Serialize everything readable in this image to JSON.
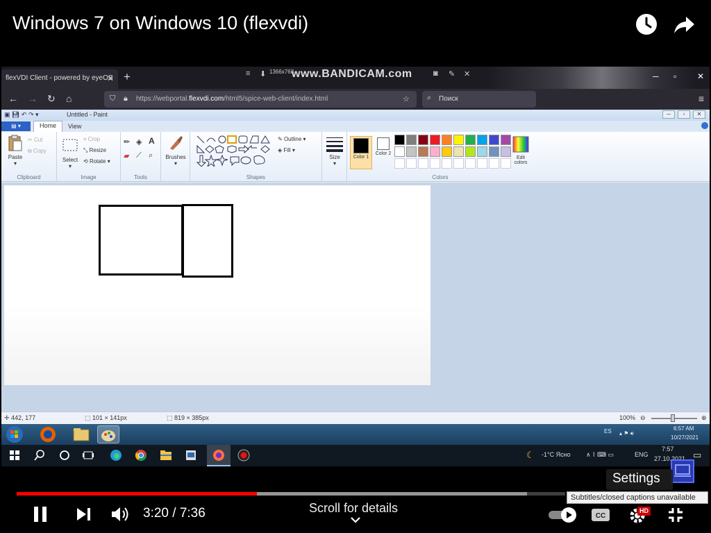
{
  "player": {
    "title": "Windows 7 on Windows 10 (flexvdi)",
    "time_current": "3:20",
    "time_total": "7:36",
    "time_display": "3:20 / 7:36",
    "progress_played": 0.438,
    "progress_buffered": 0.93,
    "scroll_hint": "Scroll for details",
    "settings_popup": "Settings",
    "cc_tooltip": "Subtitles/closed captions unavailable",
    "hd_badge": "HD",
    "autoplay_on": true,
    "colors": {
      "progress": "#ff0000",
      "hd_badge": "#cc0000"
    }
  },
  "browser": {
    "tab_title": "flexVDI Client - powered by eyeOS",
    "url_scheme": "https://webportal.",
    "url_domain": "flexvdi.com",
    "url_path": "/html5/spice-web-client/index.html",
    "search_placeholder": "Поиск",
    "watermark": "www.BANDICAM.com",
    "recording_resolution": "1366x768"
  },
  "paint": {
    "window_title": "Untitled - Paint",
    "tabs": [
      "Home",
      "View"
    ],
    "active_tab": "Home",
    "clipboard": {
      "paste": "Paste",
      "cut": "Cut",
      "copy": "Copy",
      "group": "Clipboard"
    },
    "image": {
      "select": "Select",
      "crop": "Crop",
      "resize": "Resize",
      "rotate": "Rotate",
      "group": "Image"
    },
    "tools_group": "Tools",
    "brushes": "Brushes",
    "shapes": {
      "outline": "Outline",
      "fill": "Fill",
      "group": "Shapes"
    },
    "size": "Size",
    "color1": "Color 1",
    "color2": "Color 2",
    "edit_colors": "Edit colors",
    "colors_group": "Colors",
    "palette_row1": [
      "#000000",
      "#7f7f7f",
      "#880015",
      "#ed1c24",
      "#ff7f27",
      "#fff200",
      "#22b14c",
      "#00a2e8",
      "#3f48cc",
      "#a349a4"
    ],
    "palette_row2": [
      "#ffffff",
      "#c3c3c3",
      "#b97a57",
      "#ffaec9",
      "#ffc90e",
      "#efe4b0",
      "#b5e61d",
      "#99d9ea",
      "#7092be",
      "#c8bfe7"
    ],
    "status": {
      "cursor_pos": "442, 177",
      "selection_size": "101 × 141px",
      "canvas_size": "819 × 385px",
      "zoom": "100%"
    }
  },
  "win7_tray": {
    "lang": "ES",
    "time": "6:57 AM",
    "date": "10/27/2021"
  },
  "win10_tray": {
    "weather": "-1°C Ясно",
    "lang": "ENG",
    "time": "7:57",
    "date": "27.10.2021"
  }
}
